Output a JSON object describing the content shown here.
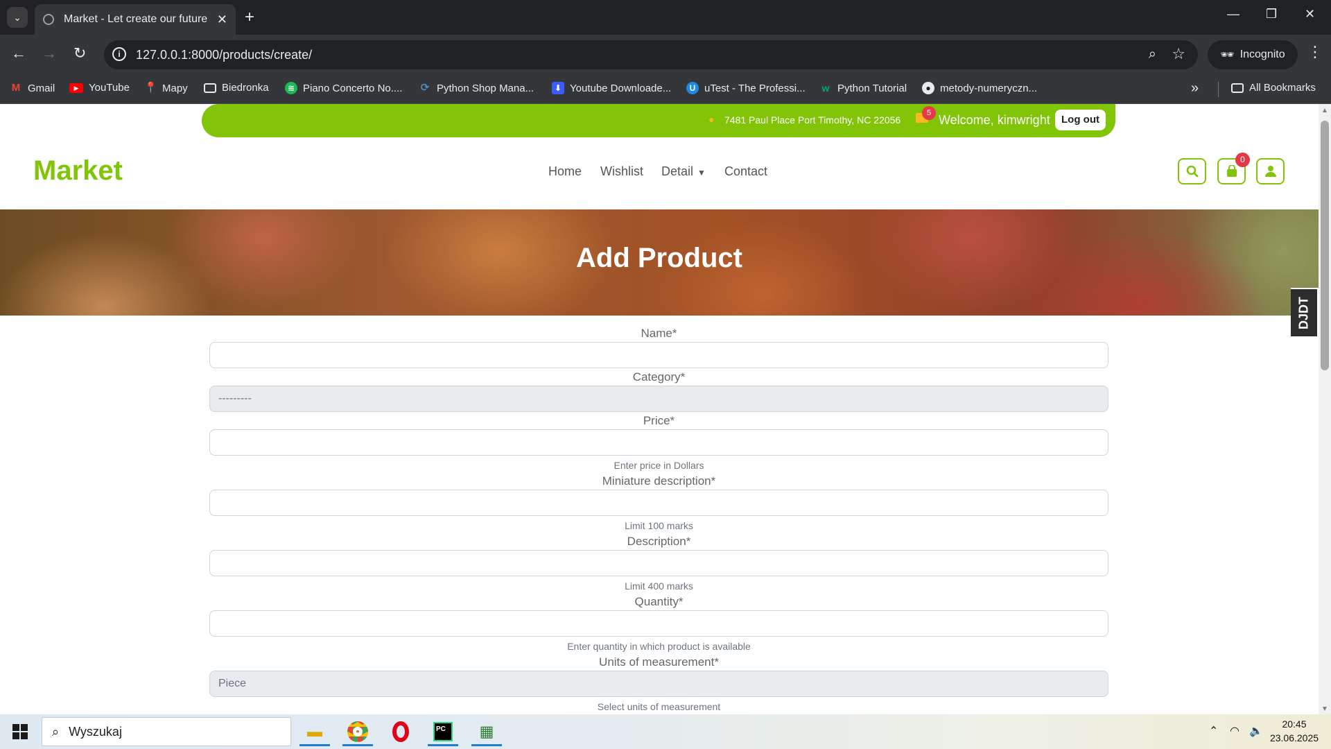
{
  "browser": {
    "tab_title": "Market - Let create our future",
    "url": "127.0.0.1:8000/products/create/",
    "incognito_label": "Incognito",
    "bookmarks": [
      {
        "label": "Gmail",
        "icon": "gmail-icon",
        "color": "#ea4335"
      },
      {
        "label": "YouTube",
        "icon": "youtube-icon",
        "color": "#ff0000"
      },
      {
        "label": "Mapy",
        "icon": "maps-icon",
        "color": "#34a853"
      },
      {
        "label": "Biedronka",
        "icon": "folder-icon",
        "color": "#e8eaed"
      },
      {
        "label": "Piano Concerto No....",
        "icon": "spotify-icon",
        "color": "#1db954"
      },
      {
        "label": "Python Shop Mana...",
        "icon": "python-icon",
        "color": "#4b8bbe"
      },
      {
        "label": "Youtube Downloade...",
        "icon": "download-icon",
        "color": "#3d5afe"
      },
      {
        "label": "uTest - The Professi...",
        "icon": "utest-icon",
        "color": "#1e88e5"
      },
      {
        "label": "Python Tutorial",
        "icon": "w3schools-icon",
        "color": "#04aa6d"
      },
      {
        "label": "metody-numeryczn...",
        "icon": "github-icon",
        "color": "#e8eaed"
      }
    ],
    "all_bookmarks_label": "All Bookmarks"
  },
  "site": {
    "address": "7481 Paul Place Port Timothy, NC 22056",
    "mail_badge": "5",
    "welcome": "Welcome, kimwright",
    "logout": "Log out",
    "brand": "Market",
    "nav": [
      "Home",
      "Wishlist",
      "Detail",
      "Contact"
    ],
    "cart_badge": "0",
    "accent_color": "#81c408",
    "hero_title": "Add Product",
    "debug_toolbar": "DJDT"
  },
  "form": {
    "name_label": "Name*",
    "category_label": "Category*",
    "category_value": "---------",
    "price_label": "Price*",
    "price_help": "Enter price in Dollars",
    "mini_desc_label": "Miniature description*",
    "mini_desc_help": "Limit 100 marks",
    "desc_label": "Description*",
    "desc_help": "Limit 400 marks",
    "quantity_label": "Quantity*",
    "quantity_help": "Enter quantity in which product is available",
    "units_label": "Units of measurement*",
    "units_value": "Piece",
    "units_help": "Select units of measurement"
  },
  "taskbar": {
    "search_placeholder": "Wyszukaj",
    "time": "20:45",
    "date": "23.06.2025"
  }
}
